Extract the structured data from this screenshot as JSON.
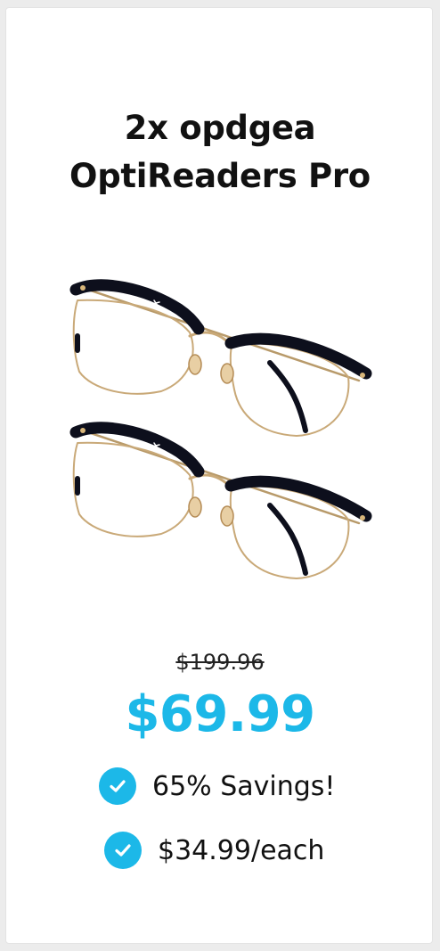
{
  "product": {
    "title_line1": "2x opdgea",
    "title_line2": "OptiReaders Pro",
    "image_icon": "eyeglasses-image"
  },
  "pricing": {
    "original_price": "$199.96",
    "sale_price": "$69.99",
    "accent_color": "#1cb8e8"
  },
  "features": [
    {
      "icon": "check-circle-icon",
      "label": "65% Savings!"
    },
    {
      "icon": "check-circle-icon",
      "label": "$34.99/each"
    }
  ]
}
